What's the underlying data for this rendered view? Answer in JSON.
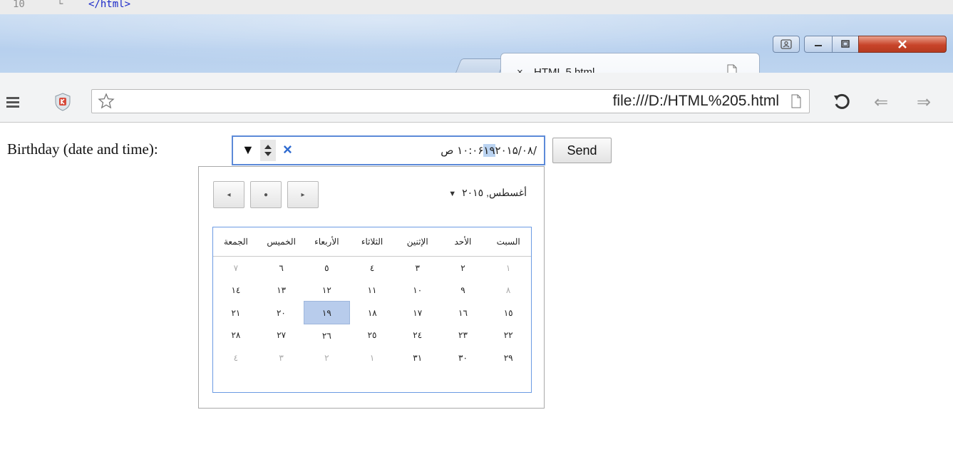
{
  "editor": {
    "line_number": "10",
    "fold_marker": "└",
    "code": "</html>"
  },
  "window": {
    "tab_title": "HTML 5.html",
    "tab_close": "×",
    "buttons": {
      "min": "minimize",
      "max": "maximize",
      "close": "close"
    }
  },
  "toolbar": {
    "url": "file:///D:/HTML%205.html",
    "back_glyph": "⇐",
    "forward_glyph": "⇒",
    "icons": [
      "menu-icon",
      "extension-icon",
      "star-icon",
      "page-icon",
      "reload-icon"
    ]
  },
  "form": {
    "label": "Birthday (date and time):",
    "input": {
      "dropdown_glyph": "▼",
      "clear_glyph": "×",
      "value_date_prefix": "۲۰۱۵/۰۸/",
      "value_day_selected": "۱۹",
      "value_time": " ۱۰:۰۶ ص"
    },
    "send_label": "Send"
  },
  "calendar": {
    "month_label": "أغسطس, ٢٠١٥",
    "nav": {
      "prev": "◂",
      "today": "●",
      "next": "▸"
    },
    "weekdays": [
      "السبت",
      "الأحد",
      "الإثنين",
      "الثلاثاء",
      "الأربعاء",
      "الخميس",
      "الجمعة"
    ],
    "weeks": [
      [
        "١",
        "٢",
        "٣",
        "٤",
        "٥",
        "٦",
        "٧"
      ],
      [
        "٨",
        "٩",
        "١٠",
        "١١",
        "١٢",
        "١٣",
        "١٤"
      ],
      [
        "١٥",
        "١٦",
        "١٧",
        "١٨",
        "١٩",
        "٢٠",
        "٢١"
      ],
      [
        "٢٢",
        "٢٣",
        "٢٤",
        "٢٥",
        "٢٦",
        "٢٧",
        "٢٨"
      ],
      [
        "٢٩",
        "٣٠",
        "٣١",
        "١",
        "٢",
        "٣",
        "٤"
      ]
    ],
    "dim_cells": [
      [
        0,
        0
      ],
      [
        0,
        6
      ],
      [
        1,
        0
      ],
      [
        4,
        3
      ],
      [
        4,
        4
      ],
      [
        4,
        5
      ],
      [
        4,
        6
      ]
    ],
    "selected_cell": [
      2,
      4
    ],
    "colors": {
      "accent": "#5c8ad8",
      "selected": "#b8ccec",
      "dim": "#aaaaaa"
    }
  }
}
